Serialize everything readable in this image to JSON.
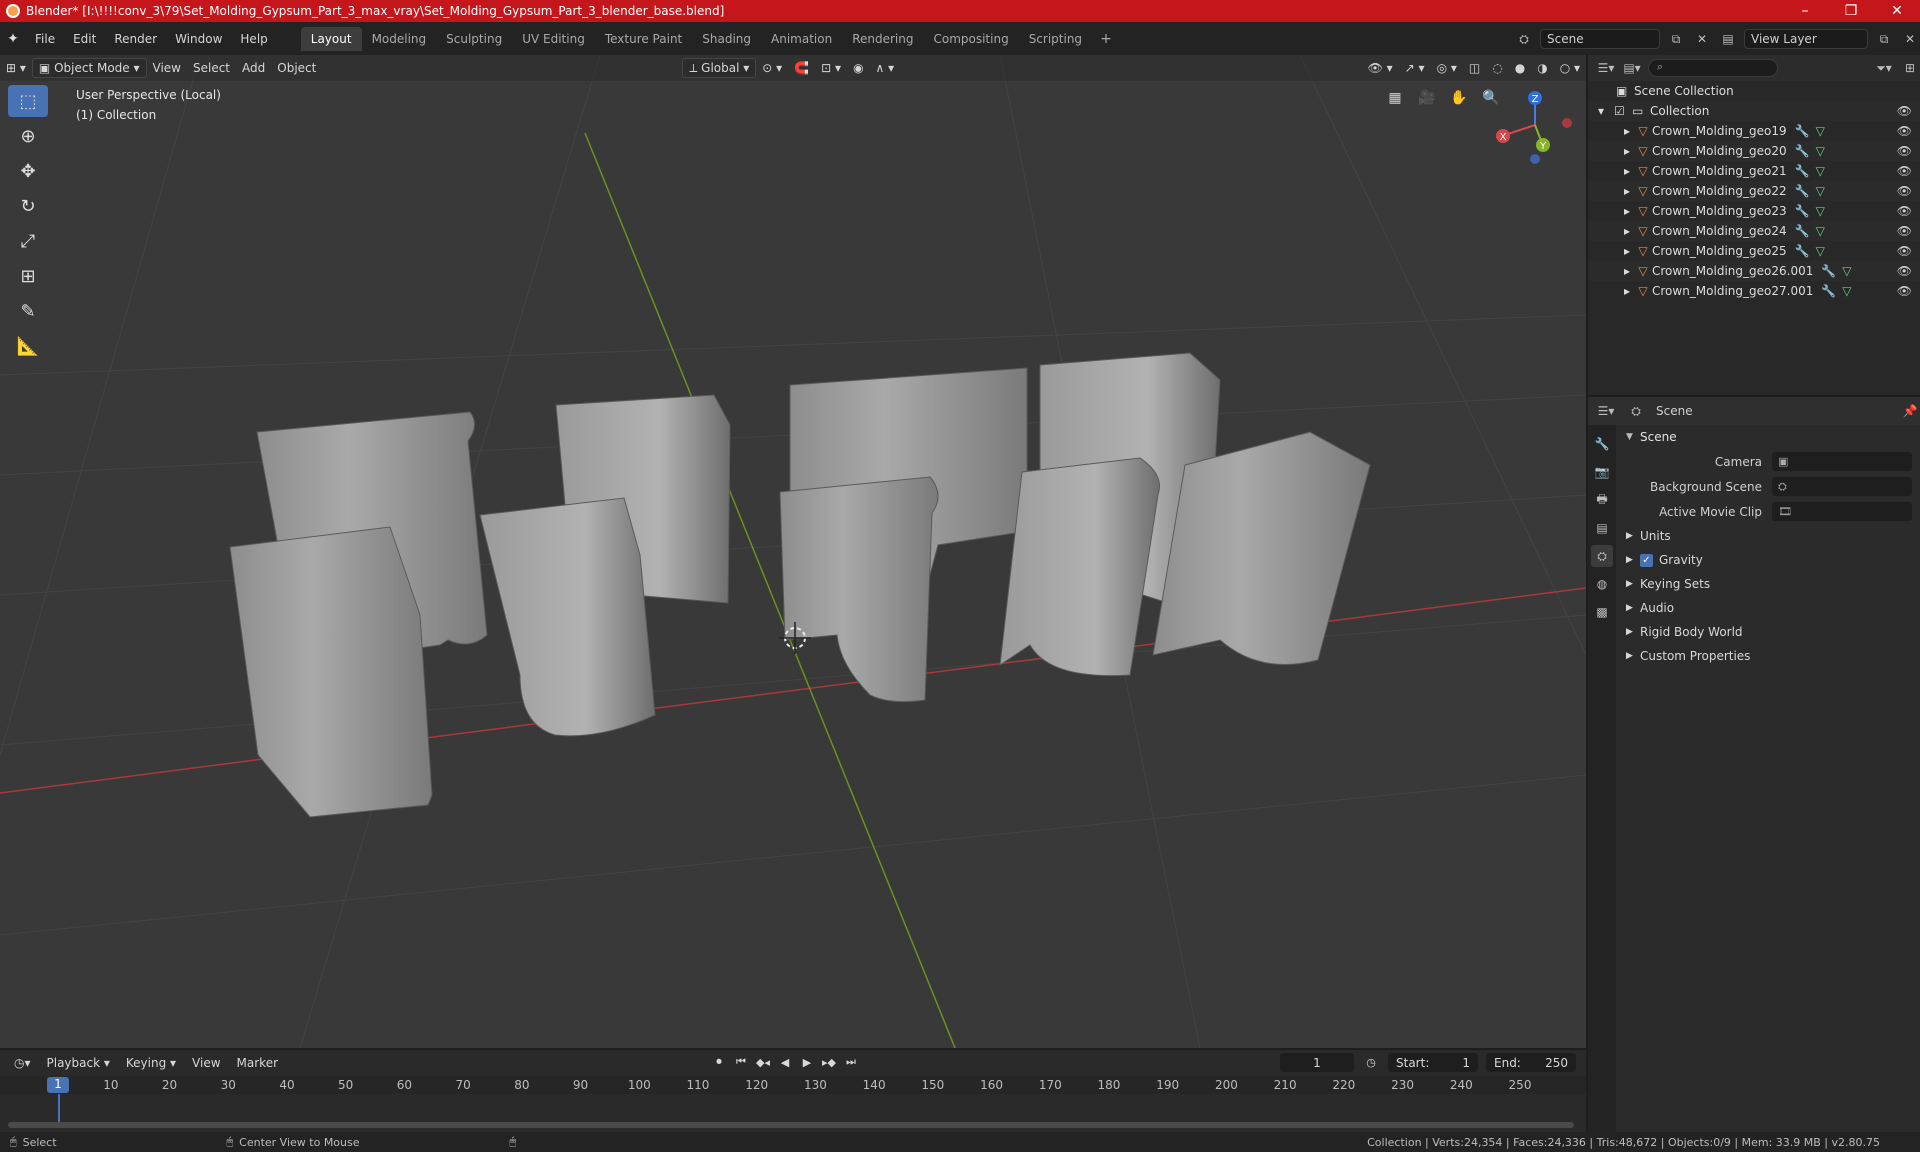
{
  "titlebar": {
    "title": "Blender* [I:\\!!!!conv_3\\79\\Set_Molding_Gypsum_Part_3_max_vray\\Set_Molding_Gypsum_Part_3_blender_base.blend]",
    "minimize": "–",
    "maximize": "❐",
    "close": "✕"
  },
  "menu": [
    "File",
    "Edit",
    "Render",
    "Window",
    "Help"
  ],
  "workspaces": [
    "Layout",
    "Modeling",
    "Sculpting",
    "UV Editing",
    "Texture Paint",
    "Shading",
    "Animation",
    "Rendering",
    "Compositing",
    "Scripting"
  ],
  "active_workspace": "Layout",
  "topbar_right": {
    "scene": "Scene",
    "view_layer": "View Layer"
  },
  "viewport": {
    "mode": "Object Mode",
    "menus": [
      "View",
      "Select",
      "Add",
      "Object"
    ],
    "transform": "Global",
    "info_line1": "User Perspective (Local)",
    "info_line2": "(1) Collection",
    "gizmo": {
      "x": "X",
      "y": "Y",
      "z": "Z"
    }
  },
  "outliner": {
    "search_placeholder": "⌕",
    "root": "Scene Collection",
    "collection": "Collection",
    "items": [
      "Crown_Molding_geo19",
      "Crown_Molding_geo20",
      "Crown_Molding_geo21",
      "Crown_Molding_geo22",
      "Crown_Molding_geo23",
      "Crown_Molding_geo24",
      "Crown_Molding_geo25",
      "Crown_Molding_geo26.001",
      "Crown_Molding_geo27.001"
    ]
  },
  "properties": {
    "context": "Scene",
    "panel": "Scene",
    "camera_label": "Camera",
    "background_label": "Background Scene",
    "movieclip_label": "Active Movie Clip",
    "subpanels": [
      "Units",
      "Gravity",
      "Keying Sets",
      "Audio",
      "Rigid Body World",
      "Custom Properties"
    ]
  },
  "timeline": {
    "menus": [
      "Playback",
      "Keying",
      "View",
      "Marker"
    ],
    "current_frame": "1",
    "start_label": "Start:",
    "start": "1",
    "end_label": "End:",
    "end": "250",
    "ticks": [
      "1",
      "10",
      "20",
      "30",
      "40",
      "50",
      "60",
      "70",
      "80",
      "90",
      "100",
      "110",
      "120",
      "130",
      "140",
      "150",
      "160",
      "170",
      "180",
      "190",
      "200",
      "210",
      "220",
      "230",
      "240",
      "250"
    ]
  },
  "statusbar": {
    "select": "Select",
    "center": "Center View to Mouse",
    "stats": "Collection | Verts:24,354 | Faces:24,336 | Tris:48,672 | Objects:0/9 | Mem: 33.9 MB | v2.80.75"
  },
  "colors": {
    "titlebar": "#c5171b",
    "accent": "#4772b3",
    "object_icon": "#e8913b",
    "mesh_icon": "#5fd38a"
  }
}
